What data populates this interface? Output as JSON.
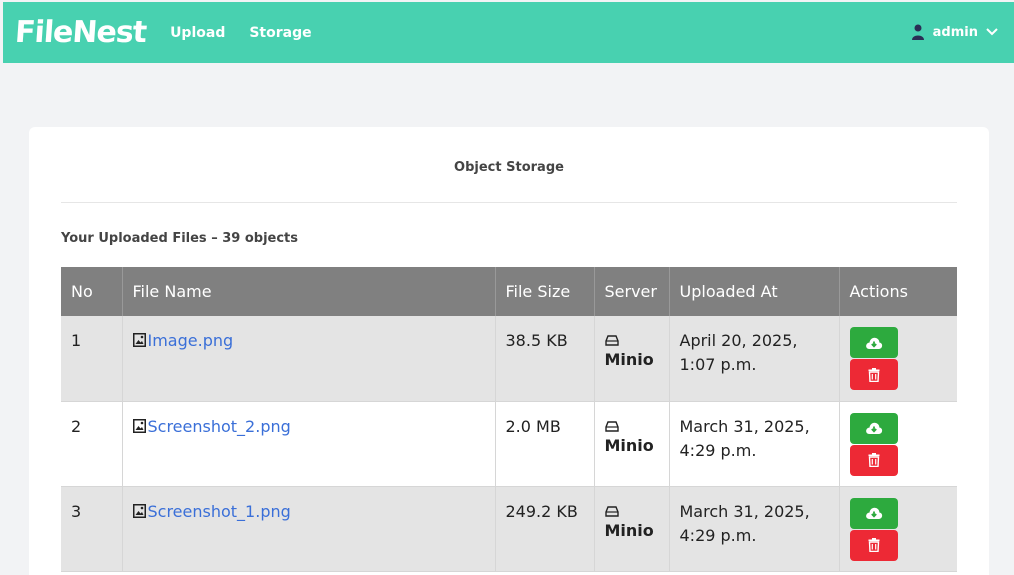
{
  "navbar": {
    "brand": "FileNest",
    "links": [
      "Upload",
      "Storage"
    ],
    "user": "admin",
    "bg_color": "#48d1b0"
  },
  "card": {
    "title": "Object Storage",
    "subtitle": "Your Uploaded Files – 39 objects"
  },
  "table": {
    "headers": [
      "No",
      "File Name",
      "File Size",
      "Server",
      "Uploaded At",
      "Actions"
    ],
    "rows": [
      {
        "no": "1",
        "name": "Image.png",
        "size": "38.5 KB",
        "server": "Minio",
        "uploaded": "April 20, 2025, 1:07 p.m."
      },
      {
        "no": "2",
        "name": "Screenshot_2.png",
        "size": "2.0 MB",
        "server": "Minio",
        "uploaded": "March 31, 2025, 4:29 p.m."
      },
      {
        "no": "3",
        "name": "Screenshot_1.png",
        "size": "249.2 KB",
        "server": "Minio",
        "uploaded": "March 31, 2025, 4:29 p.m."
      }
    ]
  },
  "icons": {
    "file": "image-file-icon",
    "server": "hard-drive-icon",
    "download": "cloud-download-icon",
    "delete": "trash-icon",
    "user": "user-icon",
    "dropdown": "chevron-down-icon"
  },
  "colors": {
    "download": "#2daa3e",
    "delete": "#ed2935",
    "header": "#808080",
    "link": "#3a6fd8"
  }
}
